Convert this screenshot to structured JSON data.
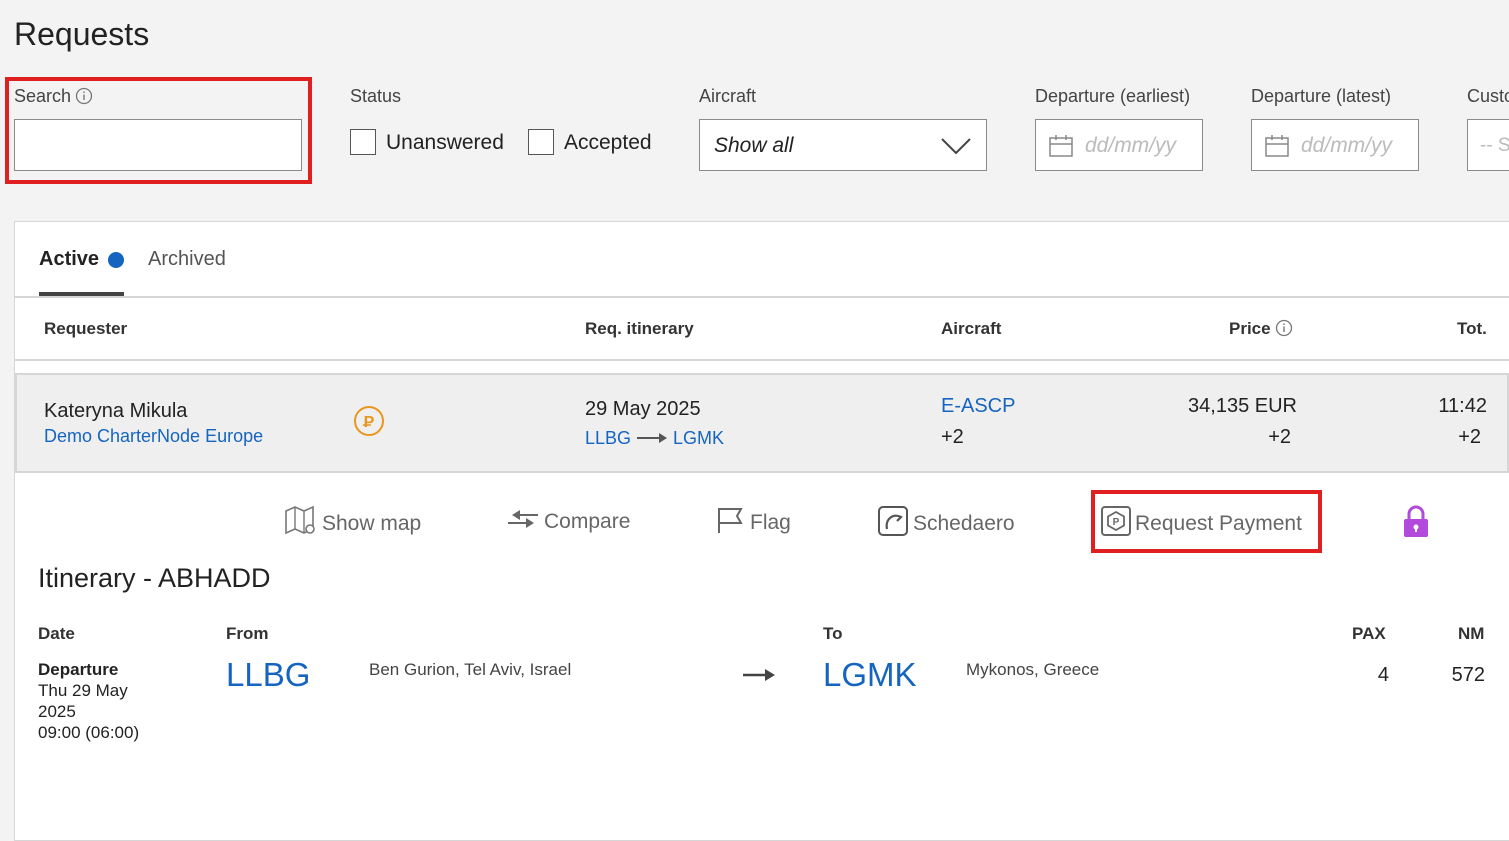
{
  "page": {
    "title": "Requests"
  },
  "filters": {
    "search_label": "Search",
    "search_value": "",
    "status_label": "Status",
    "status_unanswered": "Unanswered",
    "status_accepted": "Accepted",
    "aircraft_label": "Aircraft",
    "aircraft_value": "Show all",
    "dep_earliest_label": "Departure (earliest)",
    "dep_earliest_placeholder": "dd/mm/yy",
    "dep_latest_label": "Departure (latest)",
    "dep_latest_placeholder": "dd/mm/yy",
    "customer_label": "Custo",
    "customer_placeholder": "-- S"
  },
  "tabs": {
    "active": "Active",
    "archived": "Archived"
  },
  "table": {
    "headers": {
      "requester": "Requester",
      "itinerary": "Req. itinerary",
      "aircraft": "Aircraft",
      "price": "Price",
      "total": "Tot."
    },
    "row": {
      "requester_name": "Kateryna Mikula",
      "requester_company": "Demo CharterNode Europe",
      "date": "29 May 2025",
      "from_code": "LLBG",
      "to_code": "LGMK",
      "aircraft": "E-ASCP",
      "aircraft_more": "+2",
      "price": "34,135 EUR",
      "price_more": "+2",
      "total": "11:42",
      "total_more": "+2"
    }
  },
  "actions": {
    "show_map": "Show map",
    "compare": "Compare",
    "flag": "Flag",
    "schedaero": "Schedaero",
    "request_payment": "Request Payment"
  },
  "itinerary": {
    "title": "Itinerary - ABHADD",
    "headers": {
      "date": "Date",
      "from": "From",
      "to": "To",
      "pax": "PAX",
      "nm": "NM"
    },
    "leg": {
      "type": "Departure",
      "date_line1": "Thu 29 May",
      "date_line2": "2025",
      "time": "09:00 (06:00)",
      "from_code": "LLBG",
      "from_place": "Ben Gurion, Tel Aviv, Israel",
      "to_code": "LGMK",
      "to_place": "Mykonos, Greece",
      "pax": "4",
      "nm": "572"
    }
  },
  "colors": {
    "link": "#1565c0",
    "highlight": "#e02020",
    "payment_icon": "#e8961e",
    "lock": "#b24bdc",
    "tab_dot": "#1565c0"
  }
}
